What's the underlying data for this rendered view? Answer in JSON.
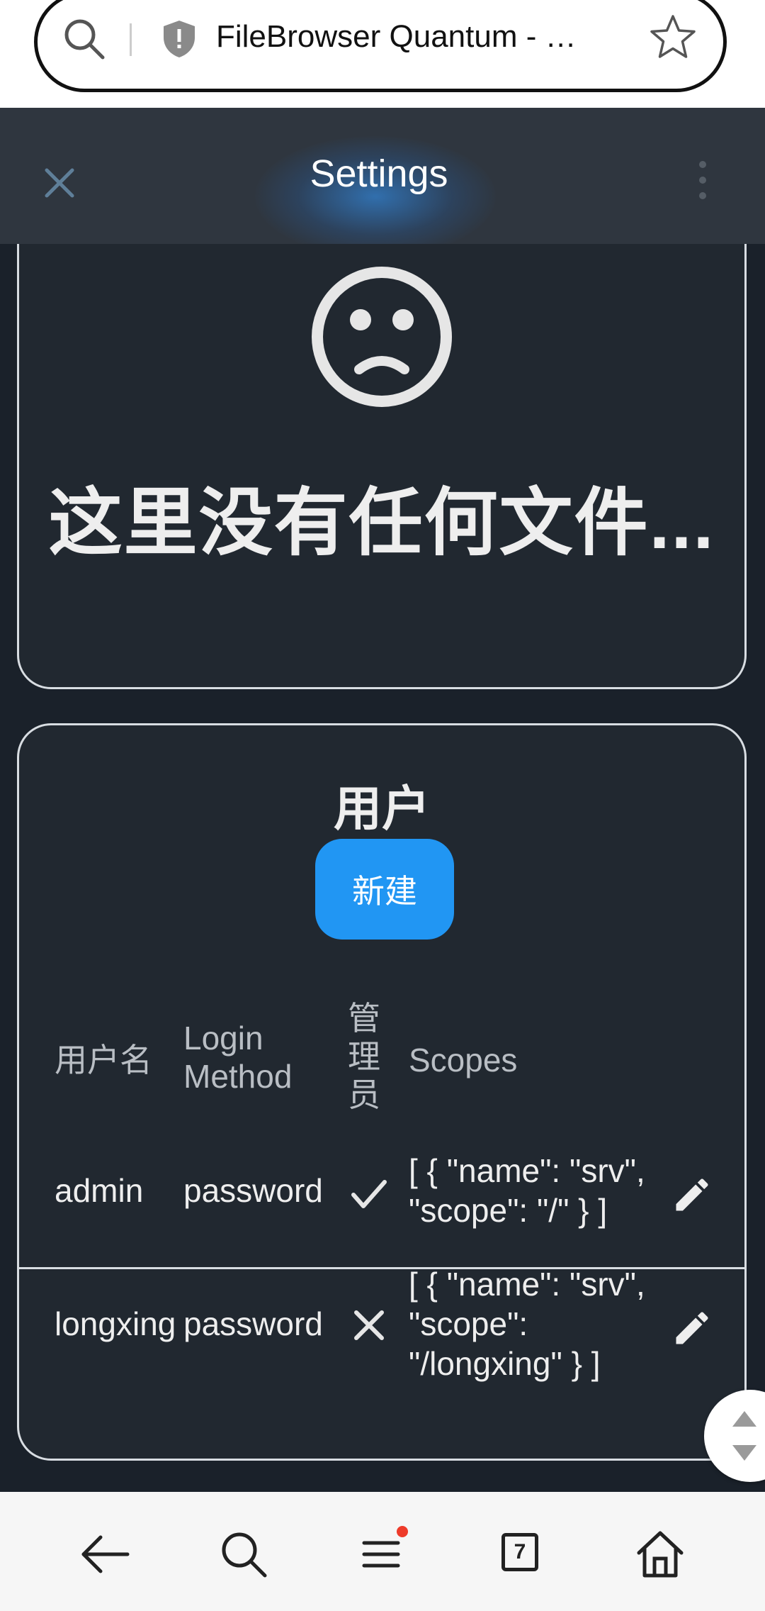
{
  "browser": {
    "tab_title": "FileBrowser Quantum - …",
    "tab_count": "7"
  },
  "header": {
    "title": "Settings"
  },
  "empty_state": {
    "message": "这里没有任何文件..."
  },
  "users": {
    "title": "用户",
    "new_button": "新建",
    "columns": {
      "username": "用户名",
      "login_method_1": "Login",
      "login_method_2": "Method",
      "admin_1": "管",
      "admin_2": "理",
      "admin_3": "员",
      "scopes": "Scopes"
    },
    "rows": [
      {
        "username": "admin",
        "login_method": "password",
        "admin": true,
        "scopes_lines": [
          "[ { \"name\": \"srv\",",
          "\"scope\": \"/\" } ]"
        ]
      },
      {
        "username": "longxing",
        "login_method": "password",
        "admin": false,
        "scopes_lines": [
          "[ { \"name\": \"srv\",",
          "\"scope\":",
          "\"/longxing\" } ]"
        ]
      }
    ]
  },
  "colors": {
    "accent": "#2196f3",
    "background": "#1a212a",
    "card": "#212830",
    "header": "#2f363f"
  }
}
